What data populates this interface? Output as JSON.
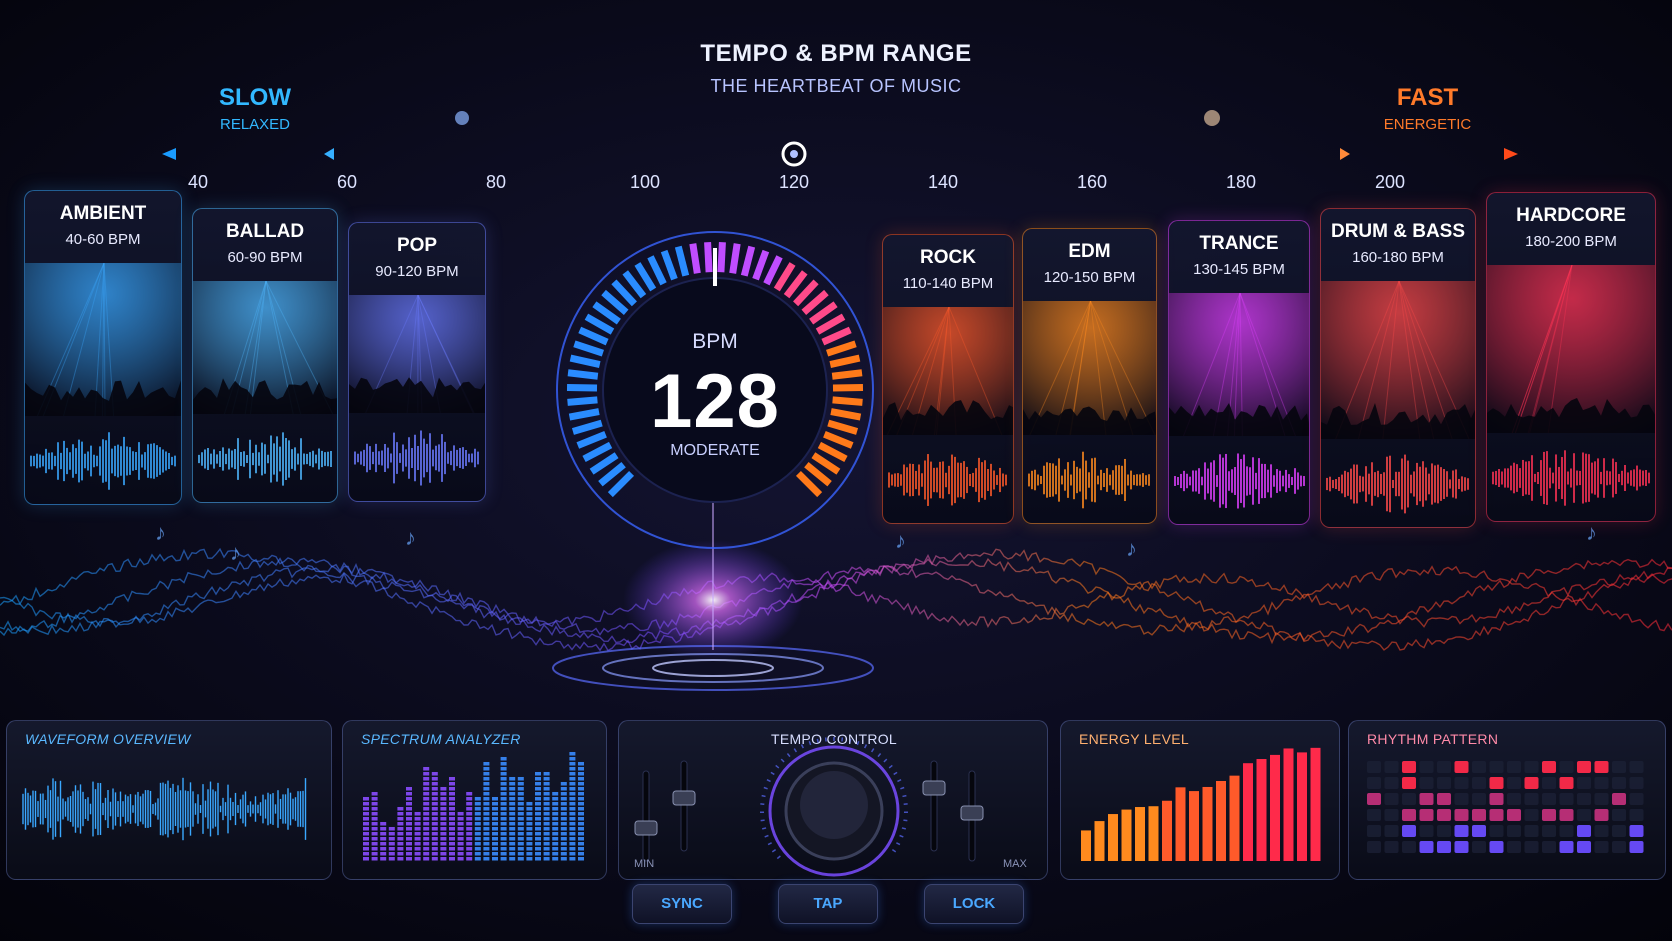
{
  "header": {
    "title": "TEMPO & BPM RANGE",
    "subtitle": "THE HEARTBEAT OF MUSIC"
  },
  "poles": {
    "slow": {
      "label": "SLOW",
      "sub": "RELAXED",
      "color": "#32b8ff"
    },
    "fast": {
      "label": "FAST",
      "sub": "ENERGETIC",
      "color": "#ff7a2a"
    }
  },
  "scale": {
    "ticks": [
      "40",
      "60",
      "80",
      "100",
      "120",
      "140",
      "160",
      "180",
      "200"
    ],
    "marker_value": 120
  },
  "genres": [
    {
      "name": "AMBIENT",
      "range": "40-60 BPM",
      "color": "#3aa8ff"
    },
    {
      "name": "BALLAD",
      "range": "60-90 BPM",
      "color": "#4fb8ff"
    },
    {
      "name": "POP",
      "range": "90-120 BPM",
      "color": "#6b7bff"
    },
    {
      "name": "ROCK",
      "range": "110-140 BPM",
      "color": "#ff5a2a"
    },
    {
      "name": "EDM",
      "range": "120-150 BPM",
      "color": "#ff8a1e"
    },
    {
      "name": "TRANCE",
      "range": "130-145 BPM",
      "color": "#e040ff"
    },
    {
      "name": "DRUM & BASS",
      "range": "160-180 BPM",
      "color": "#ff4a4a"
    },
    {
      "name": "HARDCORE",
      "range": "180-200 BPM",
      "color": "#ff3355"
    }
  ],
  "gauge": {
    "label": "BPM",
    "value": "128",
    "mood": "MODERATE"
  },
  "panels": {
    "waveform": {
      "title": "WAVEFORM OVERVIEW"
    },
    "spectrum": {
      "title": "SPECTRUM ANALYZER"
    },
    "tempo": {
      "title": "TEMPO CONTROL",
      "min": "MIN",
      "max": "MAX"
    },
    "energy": {
      "title": "ENERGY LEVEL"
    },
    "rhythm": {
      "title": "RHYTHM PATTERN"
    }
  },
  "buttons": {
    "sync": "SYNC",
    "tap": "TAP",
    "lock": "LOCK"
  },
  "icons": [
    "music-note-icon",
    "arrow-left-icon",
    "arrow-right-icon",
    "knob-icon",
    "slider-icon"
  ]
}
